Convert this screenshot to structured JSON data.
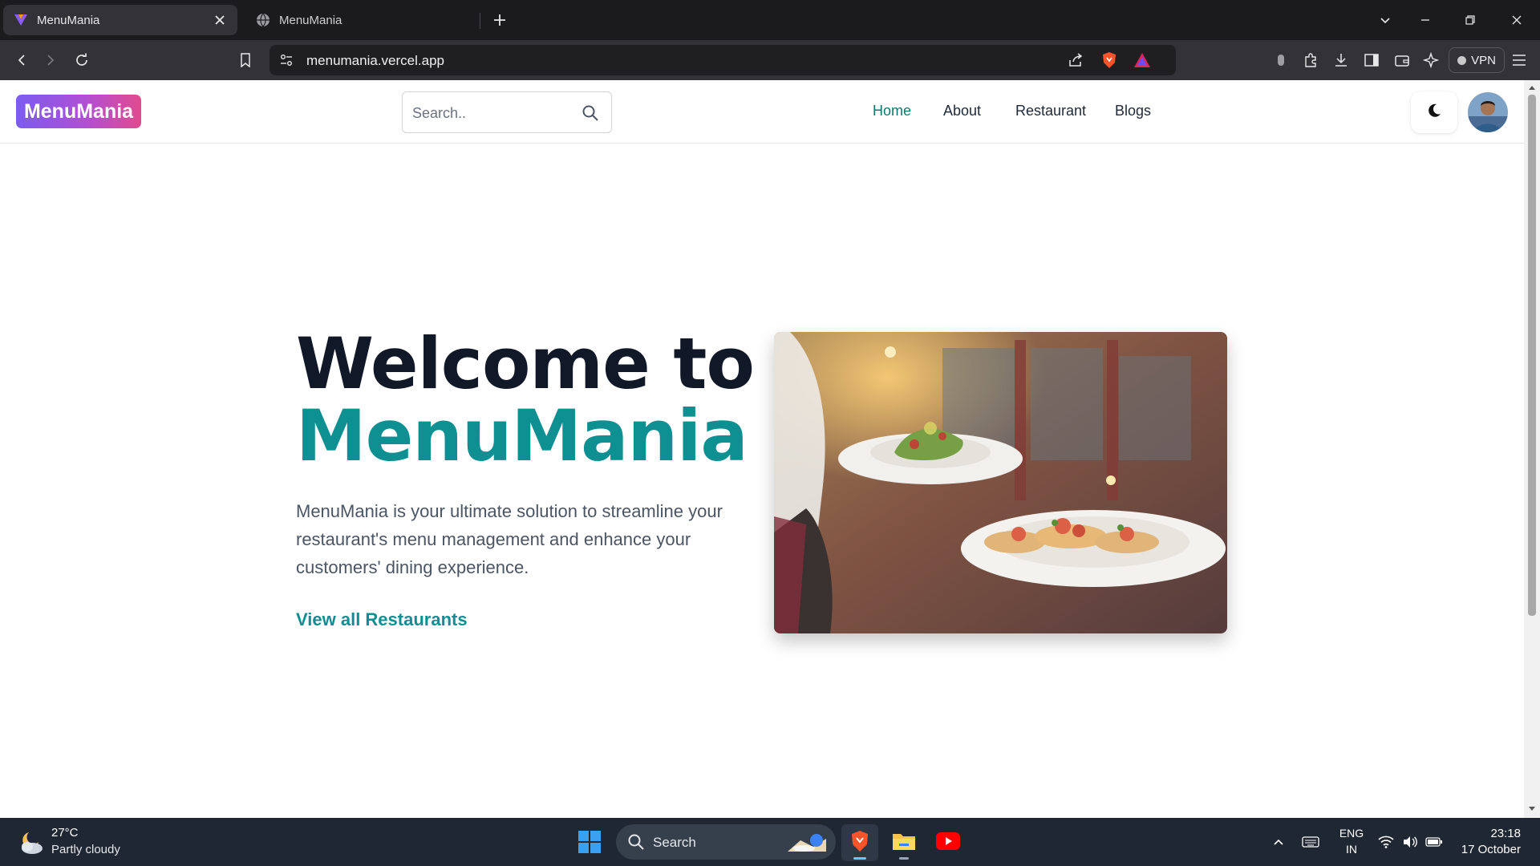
{
  "browser": {
    "tabs": [
      {
        "title": "MenuMania",
        "active": true
      },
      {
        "title": "MenuMania",
        "active": false
      }
    ],
    "url": "menumania.vercel.app",
    "vpn_label": "VPN"
  },
  "site": {
    "logo": "MenuMania",
    "search_placeholder": "Search..",
    "nav": [
      {
        "label": "Home",
        "active": true
      },
      {
        "label": "About",
        "active": false
      },
      {
        "label": "Restaurant",
        "active": false
      },
      {
        "label": "Blogs",
        "active": false
      }
    ]
  },
  "hero": {
    "title_line1": "Welcome to",
    "title_line2": "MenuMania",
    "description": "MenuMania is your ultimate solution to streamline your restaurant's menu management and enhance your customers' dining experience.",
    "cta": "View all Restaurants"
  },
  "taskbar": {
    "weather_temp": "27°C",
    "weather_desc": "Partly cloudy",
    "search_label": "Search",
    "lang_line1": "ENG",
    "lang_line2": "IN",
    "time": "23:18",
    "date": "17 October"
  },
  "colors": {
    "accent": "#0e8f92",
    "nav_active": "#0f766e",
    "heading": "#111827",
    "logo_gradient_start": "#7b5cf0",
    "logo_gradient_end": "#e14b8f"
  }
}
